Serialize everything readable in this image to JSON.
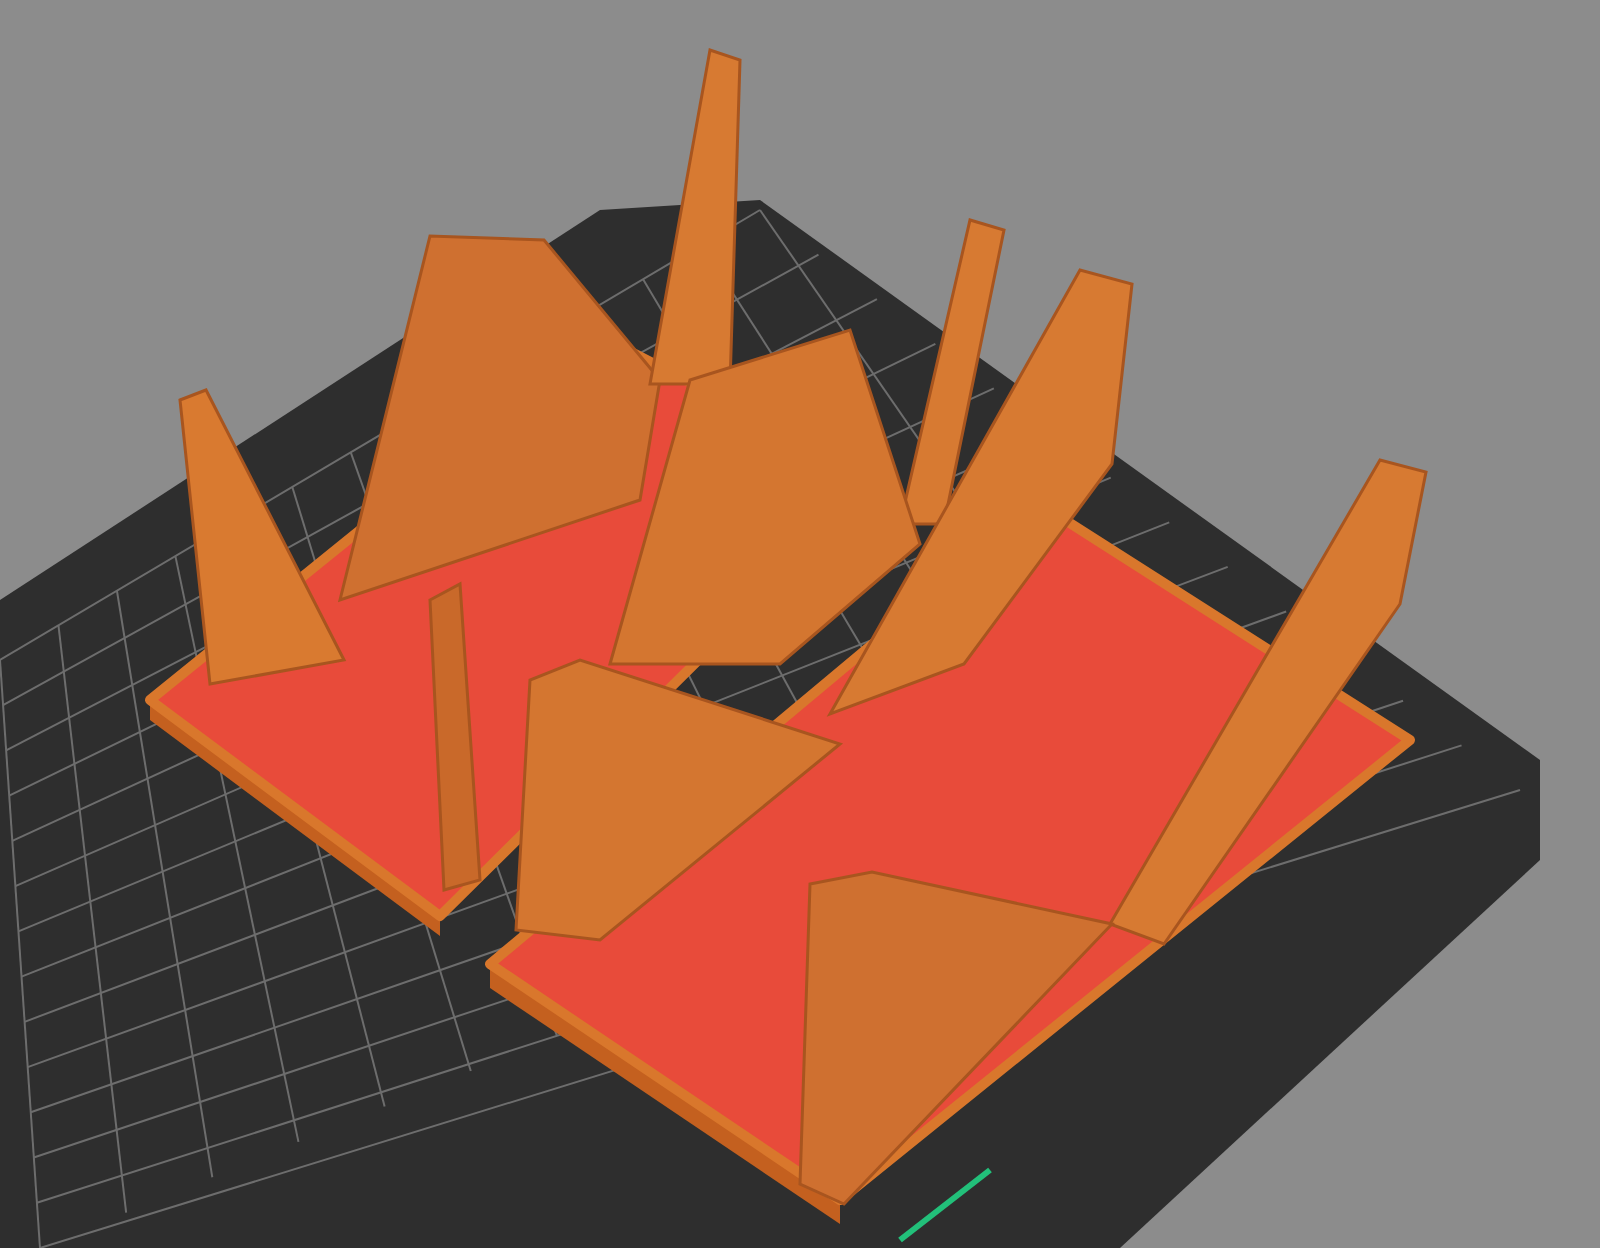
{
  "viewport": {
    "kind": "slicer-preview",
    "objects": [
      {
        "kind": "stand"
      },
      {
        "kind": "stand"
      }
    ]
  }
}
